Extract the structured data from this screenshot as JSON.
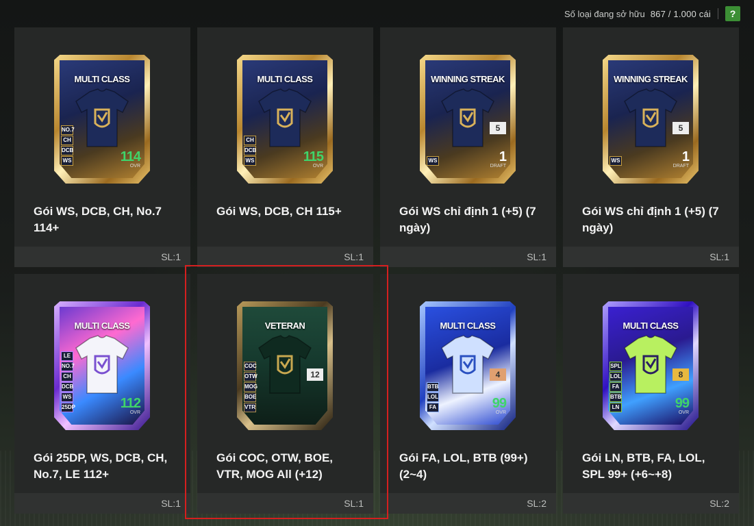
{
  "header": {
    "owned_label": "Số loại đang sở hữu",
    "owned_count": "867 / 1.000 cái",
    "help": "?"
  },
  "packs": [
    {
      "name": "Gói WS, DCB, CH, No.7 114+",
      "qty": "SL:1",
      "card_title": "MULTI CLASS",
      "tags": [
        "NO.7",
        "CH",
        "DCB",
        "WS"
      ],
      "value": "114",
      "value_label": "OVR",
      "theme": "gold"
    },
    {
      "name": "Gói WS, DCB, CH 115+",
      "qty": "SL:1",
      "card_title": "MULTI CLASS",
      "tags": [
        "CH",
        "DCB",
        "WS"
      ],
      "value": "115",
      "value_label": "OVR",
      "theme": "gold"
    },
    {
      "name": "Gói WS chỉ định 1 (+5) (7 ngày)",
      "qty": "SL:1",
      "card_title": "WINNING STREAK",
      "tags": [
        "WS"
      ],
      "value": "1",
      "value_label": "DRAFT",
      "badge": "5",
      "theme": "gold"
    },
    {
      "name": "Gói WS chỉ định 1 (+5) (7 ngày)",
      "qty": "SL:1",
      "card_title": "WINNING STREAK",
      "tags": [
        "WS"
      ],
      "value": "1",
      "value_label": "DRAFT",
      "badge": "5",
      "theme": "gold"
    },
    {
      "name": "Gói 25DP, WS, DCB, CH, No.7, LE 112+",
      "qty": "SL:1",
      "card_title": "MULTI CLASS",
      "tags": [
        "LE",
        "NO.7",
        "CH",
        "DCB",
        "WS",
        "25DP"
      ],
      "value": "112",
      "value_label": "OVR",
      "theme": "purple"
    },
    {
      "name": "Gói COC, OTW, BOE, VTR, MOG All (+12)",
      "qty": "SL:1",
      "card_title": "VETERAN",
      "tags": [
        "COC",
        "OTW",
        "MOG",
        "BOE",
        "VTR"
      ],
      "value": "",
      "value_label": "",
      "badge": "12",
      "theme": "veteran"
    },
    {
      "name": "Gói FA, LOL, BTB (99+) (2~4)",
      "qty": "SL:2",
      "card_title": "MULTI CLASS",
      "tags": [
        "BTB",
        "LOL",
        "FA"
      ],
      "value": "99",
      "value_label": "OVR",
      "badge": "4",
      "theme": "blue"
    },
    {
      "name": "Gói LN, BTB, FA, LOL, SPL 99+ (+6~+8)",
      "qty": "SL:2",
      "card_title": "MULTI CLASS",
      "tags": [
        "SPL",
        "LOL",
        "FA",
        "BTB",
        "LN"
      ],
      "value": "99",
      "value_label": "OVR",
      "badge": "8",
      "theme": "neon"
    }
  ]
}
